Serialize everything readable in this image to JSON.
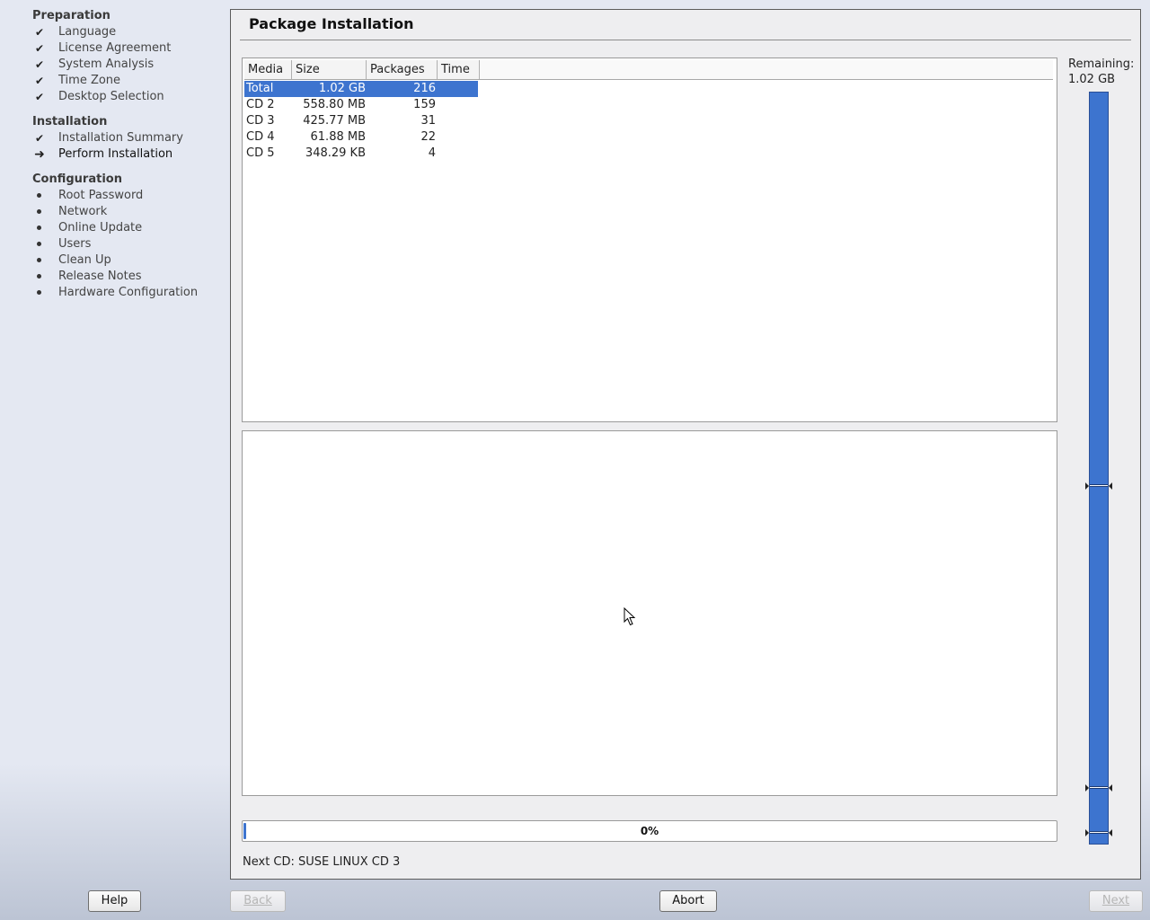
{
  "sidebar": {
    "sections": [
      {
        "title": "Preparation",
        "items": [
          {
            "label": "Language",
            "status": "done"
          },
          {
            "label": "License Agreement",
            "status": "done"
          },
          {
            "label": "System Analysis",
            "status": "done"
          },
          {
            "label": "Time Zone",
            "status": "done"
          },
          {
            "label": "Desktop Selection",
            "status": "done"
          }
        ]
      },
      {
        "title": "Installation",
        "items": [
          {
            "label": "Installation Summary",
            "status": "done"
          },
          {
            "label": "Perform Installation",
            "status": "current"
          }
        ]
      },
      {
        "title": "Configuration",
        "items": [
          {
            "label": "Root Password",
            "status": "pending"
          },
          {
            "label": "Network",
            "status": "pending"
          },
          {
            "label": "Online Update",
            "status": "pending"
          },
          {
            "label": "Users",
            "status": "pending"
          },
          {
            "label": "Clean Up",
            "status": "pending"
          },
          {
            "label": "Release Notes",
            "status": "pending"
          },
          {
            "label": "Hardware Configuration",
            "status": "pending"
          }
        ]
      }
    ]
  },
  "main": {
    "title": "Package Installation",
    "table": {
      "columns": [
        "Media",
        "Size",
        "Packages",
        "Time"
      ],
      "rows": [
        {
          "media": "Total",
          "size": "1.02 GB",
          "packages": "216",
          "time": "",
          "selected": true
        },
        {
          "media": "CD 2",
          "size": "558.80 MB",
          "packages": "159",
          "time": ""
        },
        {
          "media": "CD 3",
          "size": "425.77 MB",
          "packages": "31",
          "time": ""
        },
        {
          "media": "CD 4",
          "size": "61.88 MB",
          "packages": "22",
          "time": ""
        },
        {
          "media": "CD 5",
          "size": "348.29 KB",
          "packages": "4",
          "time": ""
        }
      ]
    },
    "progress": {
      "percent_label": "0%",
      "value": 0.0
    },
    "next_cd": "Next CD: SUSE LINUX CD 3",
    "remaining": {
      "label": "Remaining:",
      "value": "1.02 GB",
      "fill": 1.0
    }
  },
  "buttons": {
    "help": "Help",
    "back": "Back",
    "abort": "Abort",
    "next": "Next"
  },
  "colors": {
    "accent": "#3d74cf",
    "sidebar_bg": "#e4e8f2",
    "panel_bg": "#eeeef0"
  },
  "icons": {
    "done": "check-icon",
    "current": "arrow-right-icon",
    "pending": "bullet-icon"
  }
}
